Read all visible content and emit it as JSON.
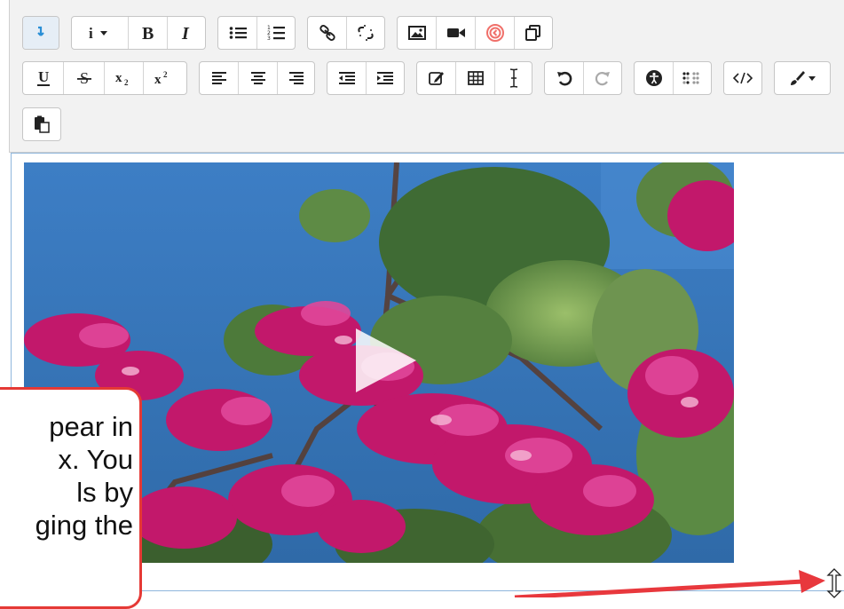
{
  "toolbar": {
    "row1": [
      {
        "group": "show-more",
        "buttons": [
          {
            "name": "show-more-buttons-button",
            "icon": "arrow-down-icon"
          }
        ]
      },
      {
        "group": "style",
        "buttons": [
          {
            "name": "paragraph-styles-button",
            "icon": "info-dropdown-icon"
          },
          {
            "name": "bold-button",
            "icon": "bold-icon"
          },
          {
            "name": "italic-button",
            "icon": "italic-icon"
          }
        ]
      },
      {
        "group": "lists",
        "buttons": [
          {
            "name": "unordered-list-button",
            "icon": "bullet-list-icon"
          },
          {
            "name": "ordered-list-button",
            "icon": "numbered-list-icon"
          }
        ]
      },
      {
        "group": "links",
        "buttons": [
          {
            "name": "link-button",
            "icon": "link-icon"
          },
          {
            "name": "unlink-button",
            "icon": "unlink-icon"
          }
        ]
      },
      {
        "group": "files",
        "buttons": [
          {
            "name": "insert-image-button",
            "icon": "image-icon"
          },
          {
            "name": "insert-media-button",
            "icon": "video-icon"
          },
          {
            "name": "record-rtc-button",
            "icon": "record-icon"
          },
          {
            "name": "manage-files-button",
            "icon": "files-icon"
          }
        ]
      }
    ],
    "row2": [
      {
        "group": "text-format",
        "buttons": [
          {
            "name": "underline-button",
            "icon": "underline-icon"
          },
          {
            "name": "strikethrough-button",
            "icon": "strikethrough-icon"
          },
          {
            "name": "subscript-button",
            "icon": "subscript-icon"
          },
          {
            "name": "superscript-button",
            "icon": "superscript-icon"
          }
        ]
      },
      {
        "group": "align",
        "buttons": [
          {
            "name": "align-left-button",
            "icon": "align-left-icon"
          },
          {
            "name": "align-center-button",
            "icon": "align-center-icon"
          },
          {
            "name": "align-right-button",
            "icon": "align-right-icon"
          }
        ]
      },
      {
        "group": "indent",
        "buttons": [
          {
            "name": "outdent-button",
            "icon": "outdent-icon"
          },
          {
            "name": "indent-button",
            "icon": "indent-icon"
          }
        ]
      },
      {
        "group": "insert",
        "buttons": [
          {
            "name": "equation-button",
            "icon": "edit-icon"
          },
          {
            "name": "table-button",
            "icon": "table-icon"
          },
          {
            "name": "clear-formatting-button",
            "icon": "text-cursor-icon"
          }
        ]
      },
      {
        "group": "undo",
        "buttons": [
          {
            "name": "undo-button",
            "icon": "undo-icon"
          },
          {
            "name": "redo-button",
            "icon": "redo-icon"
          }
        ]
      },
      {
        "group": "accessibility",
        "buttons": [
          {
            "name": "accessibility-checker-button",
            "icon": "accessibility-icon"
          },
          {
            "name": "screenreader-helper-button",
            "icon": "braille-icon"
          }
        ]
      },
      {
        "group": "html",
        "buttons": [
          {
            "name": "html-source-button",
            "icon": "code-icon"
          }
        ]
      },
      {
        "group": "color",
        "buttons": [
          {
            "name": "font-color-button",
            "icon": "paintbrush-dropdown-icon"
          }
        ]
      }
    ],
    "row3": [
      {
        "group": "paste",
        "buttons": [
          {
            "name": "paste-button",
            "icon": "paste-icon"
          }
        ]
      }
    ]
  },
  "editor": {
    "media": {
      "content": "pink-orchid-tree-flowers-against-blue-sky",
      "control_icon": "play-icon"
    },
    "resize_handle_icon": "vertical-resize-icon"
  },
  "callout": {
    "lines": [
      "pear in",
      "x. You",
      "ls by",
      "ging the"
    ],
    "border_color": "#e53935"
  },
  "colors": {
    "accent": "#e53935",
    "editor_border": "#8fb6dc",
    "toolbar_bg": "#f2f2f2",
    "sky": "#3f7fc0"
  }
}
